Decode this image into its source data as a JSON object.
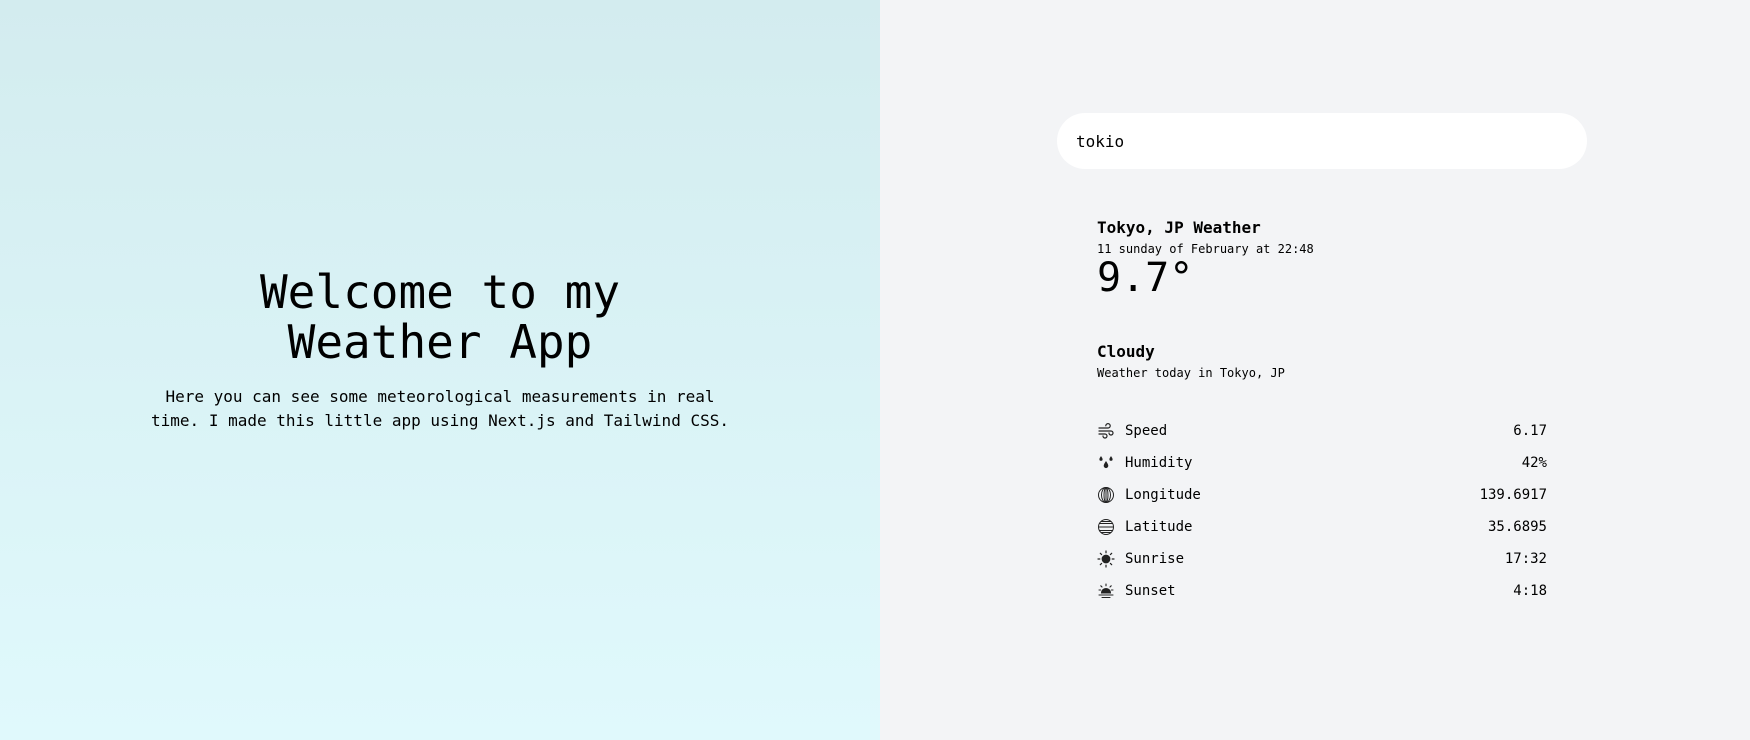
{
  "hero": {
    "title": "Welcome to my\nWeather App",
    "description": "Here you can see some meteorological measurements in real time. I made this little app using Next.js and Tailwind CSS."
  },
  "search": {
    "value": "tokio"
  },
  "weather": {
    "city": "Tokyo, JP Weather",
    "date": "11 sunday of February at 22:48",
    "temperature": "9.7°",
    "condition": "Cloudy",
    "condition_sub": "Weather today in Tokyo, JP"
  },
  "stats": [
    {
      "label": "Speed",
      "value": "6.17",
      "icon": "wind-icon"
    },
    {
      "label": "Humidity",
      "value": "42%",
      "icon": "droplets-icon"
    },
    {
      "label": "Longitude",
      "value": "139.6917",
      "icon": "globe-longitude-icon"
    },
    {
      "label": "Latitude",
      "value": "35.6895",
      "icon": "globe-latitude-icon"
    },
    {
      "label": "Sunrise",
      "value": "17:32",
      "icon": "sun-icon"
    },
    {
      "label": "Sunset",
      "value": "4:18",
      "icon": "sunset-icon"
    }
  ]
}
